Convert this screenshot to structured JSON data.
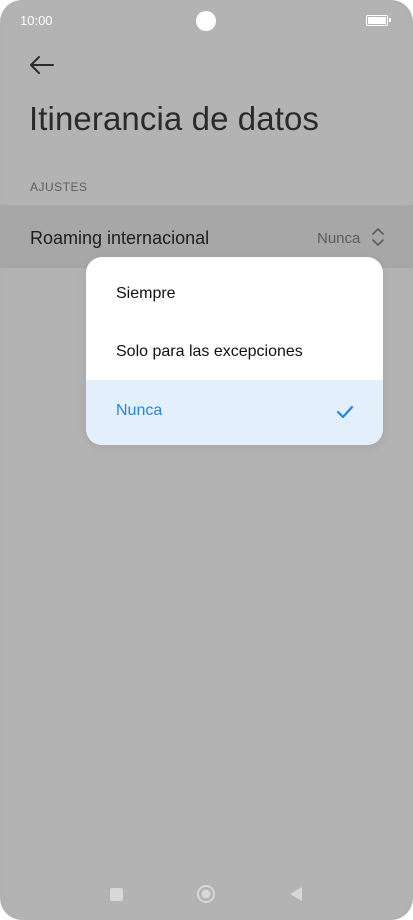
{
  "status_bar": {
    "time": "10:00"
  },
  "header": {
    "title": "Itinerancia de datos"
  },
  "section": {
    "label": "AJUSTES"
  },
  "setting_row": {
    "label": "Roaming internacional",
    "value": "Nunca"
  },
  "dropdown": {
    "options": [
      {
        "label": "Siempre",
        "selected": false
      },
      {
        "label": "Solo para las excepciones",
        "selected": false
      },
      {
        "label": "Nunca",
        "selected": true
      }
    ]
  },
  "colors": {
    "accent": "#1f86e8",
    "selected_bg": "#e4effc",
    "dim_overlay": "#b3b3b3"
  },
  "icons": {
    "back": "arrow-left-icon",
    "chevron": "chevron-up-down-icon",
    "check": "checkmark-icon",
    "nav_recent": "square-icon",
    "nav_home": "circle-icon",
    "nav_back": "triangle-left-icon"
  }
}
